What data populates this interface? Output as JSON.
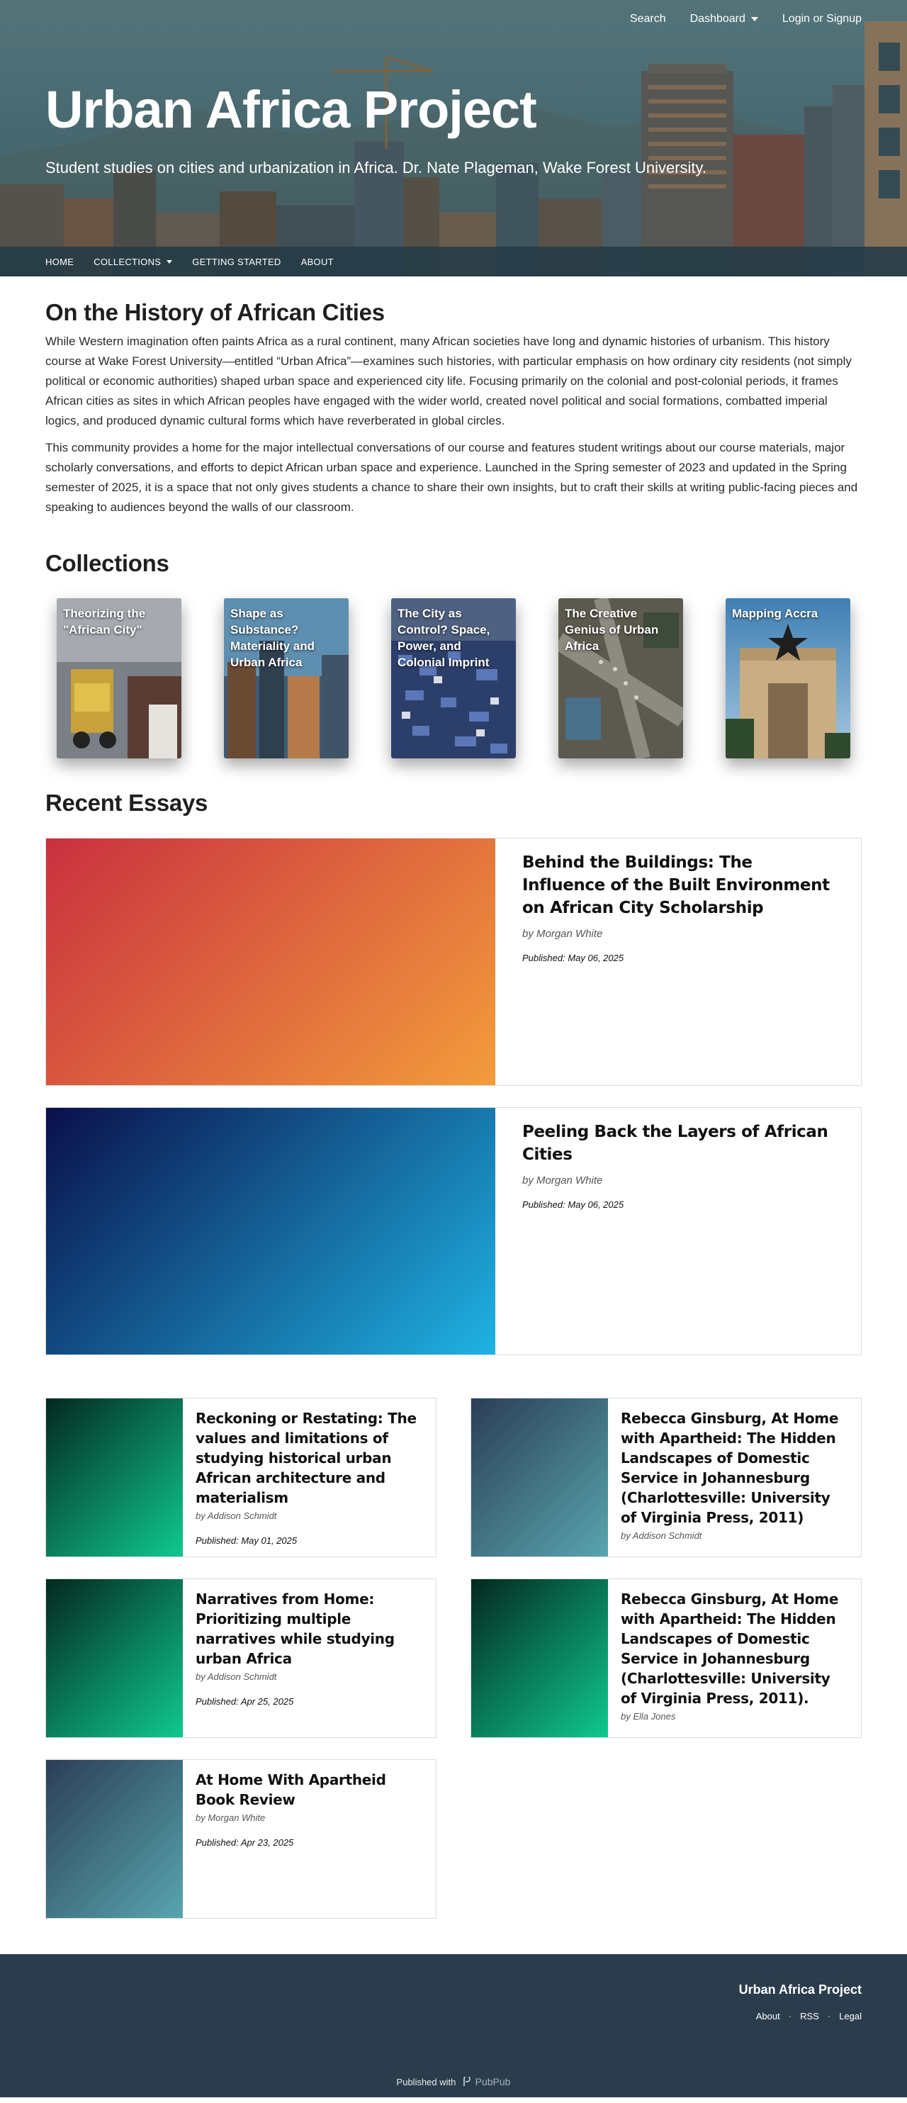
{
  "top_nav": {
    "search": "Search",
    "dashboard": "Dashboard",
    "login": "Login or Signup"
  },
  "hero": {
    "title": "Urban Africa Project",
    "subtitle": "Student studies on cities and urbanization in Africa. Dr. Nate Plageman, Wake Forest University."
  },
  "secondary_nav": {
    "items": [
      "HOME",
      "COLLECTIONS",
      "GETTING STARTED",
      "ABOUT"
    ]
  },
  "intro": {
    "heading": "On the History of African Cities",
    "paragraphs": [
      "While Western imagination often paints Africa as a rural continent, many African societies have long and dynamic histories of urbanism. This history course at Wake Forest University—entitled “Urban Africa”—examines such histories, with particular emphasis on how ordinary city residents (not simply political or economic authorities) shaped urban space and experienced city life. Focusing primarily on the colonial and post-colonial periods, it frames African cities as sites in which African peoples have engaged with the wider world, created novel political and social formations, combatted imperial logics, and produced dynamic cultural forms which have reverberated in global circles.",
      "This community provides a home for the major intellectual conversations of our course and features student writings about our course materials, major scholarly conversations, and efforts to depict African urban space and experience. Launched in the Spring semester of 2023 and updated in the Spring semester of 2025, it is a space that not only gives students a chance to share their own insights, but to craft their skills at writing public-facing pieces and speaking to audiences beyond the walls of our classroom."
    ]
  },
  "collections": {
    "heading": "Collections",
    "items": [
      {
        "title": "Theorizing the \"African City\""
      },
      {
        "title": "Shape as Substance? Materiality and Urban Africa"
      },
      {
        "title": "The City as Control? Space, Power, and Colonial Imprint"
      },
      {
        "title": "The Creative Genius of Urban Africa"
      },
      {
        "title": "Mapping Accra"
      }
    ]
  },
  "recent": {
    "heading": "Recent Essays",
    "featured": [
      {
        "title": "Behind the Buildings: The Influence of the Built Environment on African City Scholarship",
        "byline": "by Morgan White",
        "published": "Published: May 06, 2025",
        "gradient_start": "#c9303f",
        "gradient_end": "#f39c3c"
      },
      {
        "title": "Peeling Back the Layers of African Cities",
        "byline": "by Morgan White",
        "published": "Published: May 06, 2025",
        "gradient_start": "#0a0f4a",
        "gradient_end": "#1fb3e3"
      }
    ],
    "grid": [
      {
        "title": "Reckoning or Restating: The values and limitations of studying historical urban African architecture and materialism",
        "byline": "by Addison Schmidt",
        "published": "Published: May 01, 2025",
        "gradient_start": "#04291f",
        "gradient_end": "#0fc88f"
      },
      {
        "title": "Rebecca Ginsburg, At Home with Apartheid: The Hidden Landscapes of Domestic Service in Johannesburg (Charlottesville: University of Virginia Press, 2011)",
        "byline": "by Addison Schmidt",
        "published": "",
        "gradient_start": "#2b3e57",
        "gradient_end": "#58a5ae"
      },
      {
        "title": "Narratives from Home: Prioritizing multiple narratives while studying urban Africa",
        "byline": "by Addison Schmidt",
        "published": "Published: Apr 25, 2025",
        "gradient_start": "#04291f",
        "gradient_end": "#0fc88f"
      },
      {
        "title": "Rebecca Ginsburg, At Home with Apartheid: The Hidden Landscapes of Domestic Service in Johannesburg (Charlottesville: University of Virginia Press, 2011).",
        "byline": "by Ella Jones",
        "published": "",
        "gradient_start": "#04291f",
        "gradient_end": "#0fc88f"
      },
      {
        "title": "At Home With Apartheid Book Review",
        "byline": "by Morgan White",
        "published": "Published: Apr 23, 2025",
        "gradient_start": "#2b3e57",
        "gradient_end": "#58a5ae"
      }
    ]
  },
  "footer": {
    "title": "Urban Africa Project",
    "links": [
      "About",
      "RSS",
      "Legal"
    ],
    "published_with": "Published with",
    "brand": "PubPub"
  }
}
